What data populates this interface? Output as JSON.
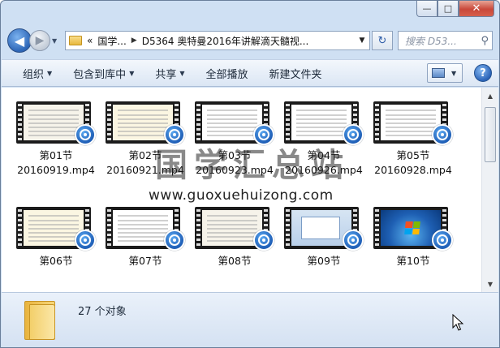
{
  "window": {
    "controls": {
      "minimize": "—",
      "maximize": "□",
      "close": "✕"
    }
  },
  "address": {
    "back_icon": "back-arrow-icon",
    "forward_icon": "forward-arrow-icon",
    "overflow": "«",
    "crumbs": [
      "国学...",
      "D5364 奥特曼2016年讲解滴天髓视..."
    ],
    "search_placeholder": "搜索 D53..."
  },
  "toolbar": {
    "organize": "组织",
    "include_library": "包含到库中",
    "share": "共享",
    "play_all": "全部播放",
    "new_folder": "新建文件夹",
    "help": "?"
  },
  "files": [
    {
      "line1": "第01节",
      "line2": "20160919.mp4",
      "thumb": "doc"
    },
    {
      "line1": "第02节",
      "line2": "20160921.mp4",
      "thumb": "doc2"
    },
    {
      "line1": "第03节",
      "line2": "20160923.mp4",
      "thumb": "doc3"
    },
    {
      "line1": "第04节",
      "line2": "20160926.mp4",
      "thumb": "doc3"
    },
    {
      "line1": "第05节",
      "line2": "20160928.mp4",
      "thumb": "doc3"
    },
    {
      "line1": "第06节",
      "line2": "",
      "thumb": "doc2"
    },
    {
      "line1": "第07节",
      "line2": "",
      "thumb": "doc3"
    },
    {
      "line1": "第08节",
      "line2": "",
      "thumb": "doc"
    },
    {
      "line1": "第09节",
      "line2": "",
      "thumb": "blue"
    },
    {
      "line1": "第10节",
      "line2": "",
      "thumb": "win7"
    }
  ],
  "watermark": {
    "title": "国学汇总站",
    "url": "www.guoxuehuizong.com"
  },
  "status": {
    "item_count": "27 个对象"
  },
  "colors": {
    "window_frame": "#cfe0f3",
    "toolbar": "#dbe6f4",
    "accent_blue": "#2d66b7",
    "close_red": "#c9483a"
  }
}
